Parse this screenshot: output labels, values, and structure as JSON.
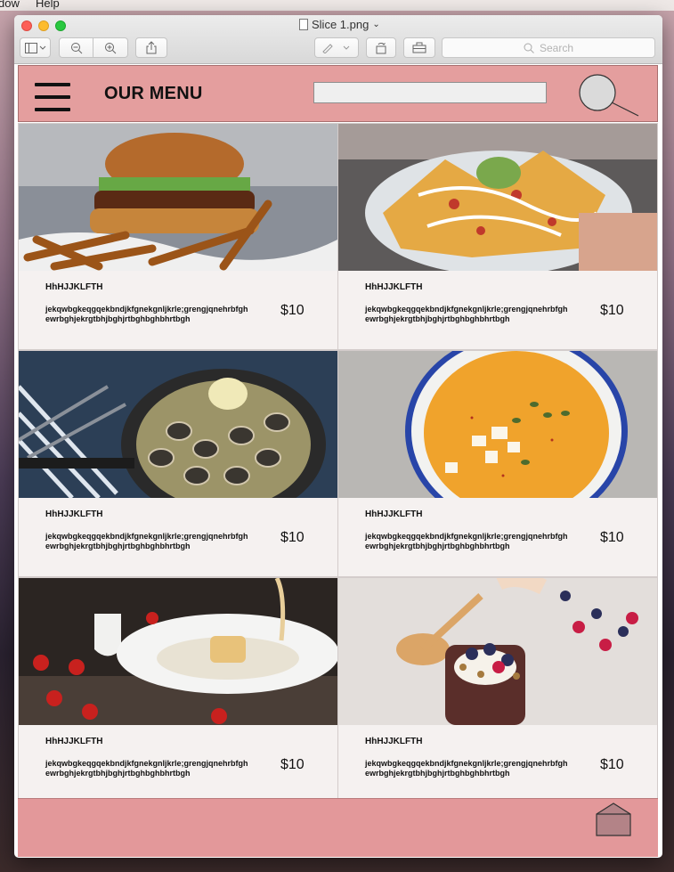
{
  "desktop": {
    "menubar_items": [
      "dow",
      "Help"
    ]
  },
  "window": {
    "title": "Slice 1.png",
    "search_placeholder": "Search"
  },
  "app": {
    "header": {
      "title": "OUR MENU",
      "search_value": ""
    },
    "items": [
      {
        "name": "HhHJJKLFTH",
        "description": "jekqwbgkeqgqekbndjkfgnekgnljkrle;grengjqnehrbfghewrbghjekrgtbhjbghjrtbghbghbhrtbgh",
        "price": "$10",
        "image": "burger-with-fries"
      },
      {
        "name": "HhHJJKLFTH",
        "description": "jekqwbgkeqgqekbndjkfgnekgnljkrle;grengjqnehrbfghewrbghjekrgtbhjbghjrtbghbghbhrtbgh",
        "price": "$10",
        "image": "loaded-nachos"
      },
      {
        "name": "HhHJJKLFTH",
        "description": "jekqwbgkeqgqekbndjkfgnekgnljkrle;grengjqnehrbfghewrbghjekrgtbhjbghjrtbghbghbhrtbgh",
        "price": "$10",
        "image": "clams-in-pan"
      },
      {
        "name": "HhHJJKLFTH",
        "description": "jekqwbgkeqgqekbndjkfgnekgnljkrle;grengjqnehrbfghewrbghjekrgtbhjbghjrtbghbghbhrtbgh",
        "price": "$10",
        "image": "pumpkin-soup"
      },
      {
        "name": "HhHJJKLFTH",
        "description": "jekqwbgkeqgqekbndjkfgnekgnljkrle;grengjqnehrbfghewrbghjekrgtbhjbghjrtbghbghbhrtbgh",
        "price": "$10",
        "image": "sponge-dessert"
      },
      {
        "name": "HhHJJKLFTH",
        "description": "jekqwbgkeqgqekbndjkfgnekgnljkrle;grengjqnehrbfghewrbghjekrgtbhjbghjrtbghbghbhrtbgh",
        "price": "$10",
        "image": "berry-parfait"
      }
    ]
  },
  "colors": {
    "header_bg": "#e49e9e",
    "footer_bg": "#e3989a",
    "card_bg": "#f5f1f0"
  }
}
